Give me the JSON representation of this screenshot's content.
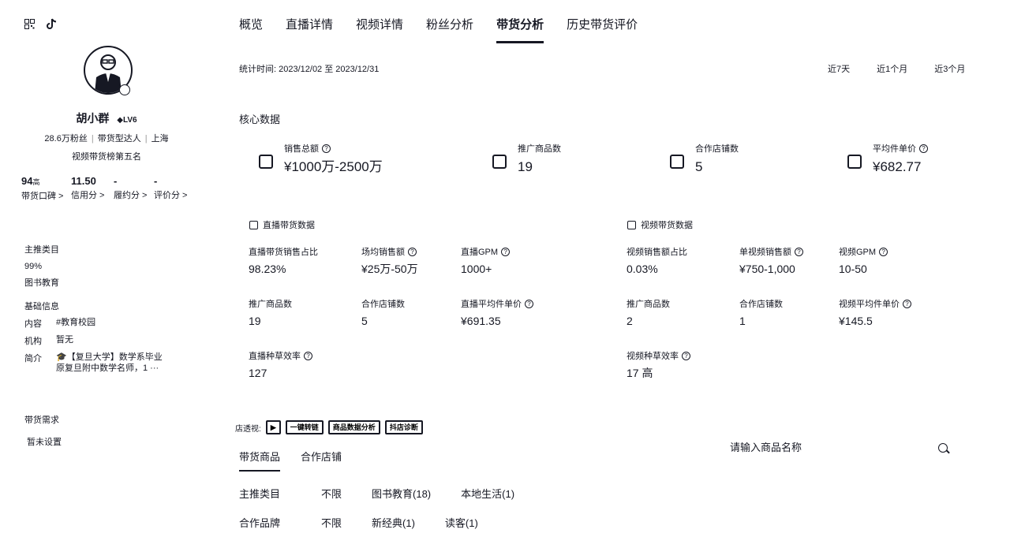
{
  "sidebar": {
    "name": "胡小群",
    "level": "LV6",
    "fans": "28.6万粉丝",
    "type": "带货型达人",
    "city": "上海",
    "title": "视频带货榜第五名",
    "scores": [
      {
        "value": "94",
        "unit": "高",
        "label": "带货口碑 >"
      },
      {
        "value": "11.50",
        "unit": "",
        "label": "信用分 >"
      },
      {
        "value": "-",
        "unit": "",
        "label": "履约分 >"
      },
      {
        "value": "-",
        "unit": "",
        "label": "评价分 >"
      }
    ],
    "main_category_title": "主推类目",
    "main_category_pct": "99%",
    "main_category_name": "图书教育",
    "basic_info_title": "基础信息",
    "content_label": "内容",
    "content_value": "#教育校园",
    "org_label": "机构",
    "org_value": "暂无",
    "intro_label": "简介",
    "intro_value_1": "🎓【复旦大学】数学系毕业",
    "intro_value_2": "原复旦附中数学名师，1 ···",
    "demand_title": "带货需求",
    "demand_value": "暂未设置"
  },
  "nav": {
    "tabs": [
      "概览",
      "直播详情",
      "视频详情",
      "粉丝分析",
      "带货分析",
      "历史带货评价"
    ],
    "active_index": 4
  },
  "range": {
    "label": "统计时间:",
    "value": "2023/12/02 至 2023/12/31",
    "periods": [
      "近7天",
      "近1个月",
      "近3个月"
    ]
  },
  "core": {
    "title": "核心数据",
    "items": [
      {
        "label": "销售总额",
        "value": "¥1000万-2500万",
        "help": true
      },
      {
        "label": "推广商品数",
        "value": "19",
        "help": false
      },
      {
        "label": "合作店铺数",
        "value": "5",
        "help": false
      },
      {
        "label": "平均件单价",
        "value": "¥682.77",
        "help": true
      }
    ]
  },
  "live": {
    "title": "直播带货数据",
    "metrics": [
      {
        "label": "直播带货销售占比",
        "value": "98.23%",
        "help": false
      },
      {
        "label": "场均销售额",
        "value": "¥25万-50万",
        "help": true
      },
      {
        "label": "直播GPM",
        "value": "1000+",
        "help": true
      },
      {
        "label": "推广商品数",
        "value": "19",
        "help": false
      },
      {
        "label": "合作店铺数",
        "value": "5",
        "help": false
      },
      {
        "label": "直播平均件单价",
        "value": "¥691.35",
        "help": true
      },
      {
        "label": "直播种草效率",
        "value": "127",
        "help": true
      }
    ]
  },
  "video": {
    "title": "视频带货数据",
    "metrics": [
      {
        "label": "视频销售额占比",
        "value": "0.03%",
        "help": false
      },
      {
        "label": "单视频销售额",
        "value": "¥750-1,000",
        "help": true
      },
      {
        "label": "视频GPM",
        "value": "10-50",
        "help": true
      },
      {
        "label": "推广商品数",
        "value": "2",
        "help": false
      },
      {
        "label": "合作店铺数",
        "value": "1",
        "help": false
      },
      {
        "label": "视频平均件单价",
        "value": "¥145.5",
        "help": true
      },
      {
        "label": "视频种草效率",
        "value": "17 高",
        "help": true
      }
    ]
  },
  "tools": {
    "label": "店透视:",
    "buttons": [
      "一键转链",
      "商品数据分析",
      "抖店诊断"
    ]
  },
  "goods": {
    "tabs": [
      "带货商品",
      "合作店铺"
    ],
    "search_placeholder": "请输入商品名称",
    "filters": [
      {
        "key": "主推类目",
        "options": [
          "不限",
          "图书教育(18)",
          "本地生活(1)"
        ]
      },
      {
        "key": "合作品牌",
        "options": [
          "不限",
          "新经典(1)",
          "读客(1)"
        ]
      }
    ]
  },
  "colors": {
    "text": "#161823",
    "background": "#ffffff"
  }
}
